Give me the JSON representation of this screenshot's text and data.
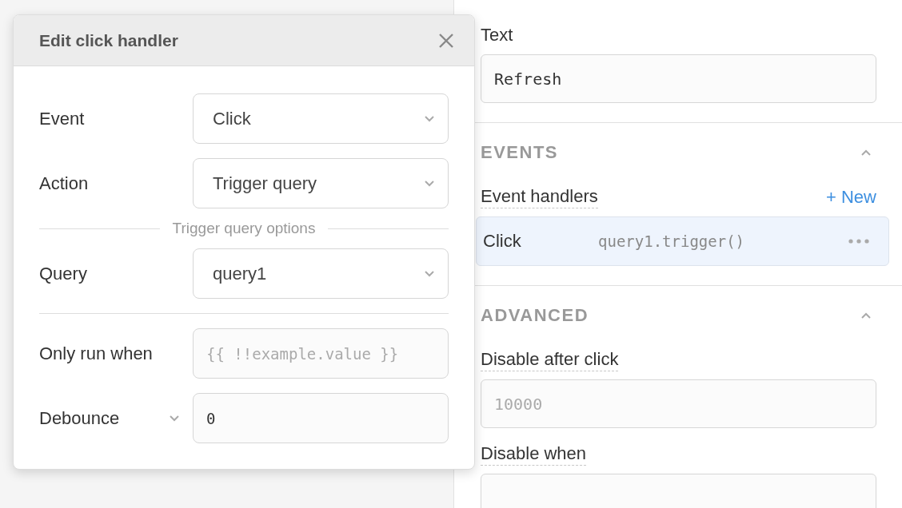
{
  "modal": {
    "title": "Edit click handler",
    "fields": [
      {
        "kind": "select",
        "label": "Event",
        "value": "Click"
      },
      {
        "kind": "select",
        "label": "Action",
        "value": "Trigger query"
      },
      {
        "kind": "section",
        "label": "Trigger query options"
      },
      {
        "kind": "select",
        "label": "Query",
        "value": "query1"
      },
      {
        "kind": "rule"
      },
      {
        "kind": "code",
        "label": "Only run when",
        "placeholder": "{{ !!example.value }}"
      },
      {
        "kind": "code",
        "label": "Debounce",
        "label_menu": true,
        "value": "0"
      }
    ]
  },
  "inspector": {
    "text_field": {
      "label": "Text",
      "value": "Refresh"
    },
    "events": {
      "title": "EVENTS",
      "expanded": true,
      "handlers_label": "Event handlers",
      "new_label": "+ New",
      "handlers": [
        {
          "event": "Click",
          "action": "query1.trigger()",
          "selected": true
        }
      ]
    },
    "advanced": {
      "title": "ADVANCED",
      "expanded": true,
      "fields": [
        {
          "label": "Disable after click",
          "placeholder": "10000"
        },
        {
          "label": "Disable when"
        }
      ]
    }
  }
}
